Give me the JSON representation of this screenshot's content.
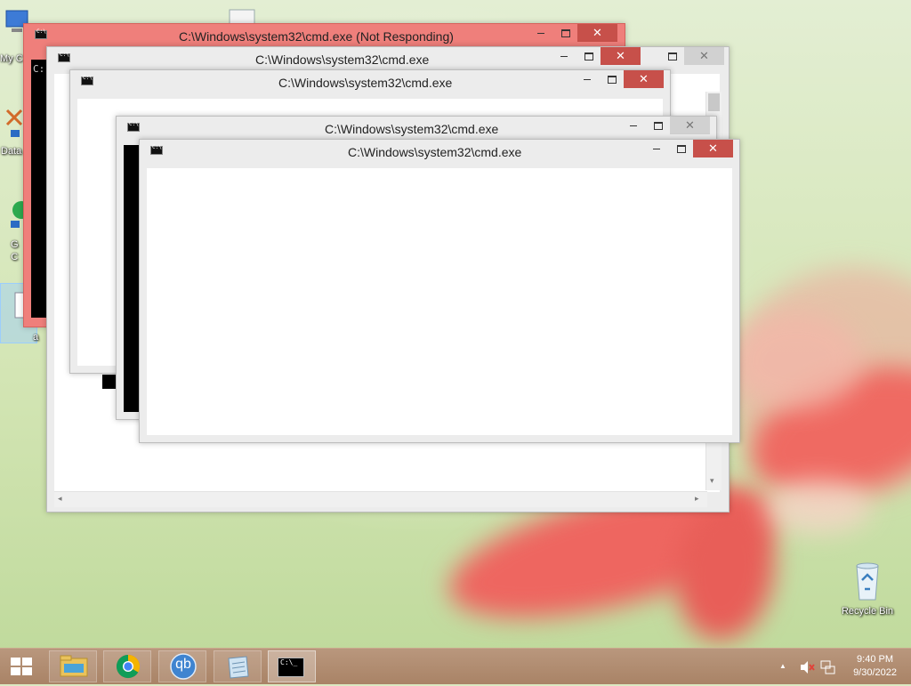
{
  "desktop": {
    "icons": [
      {
        "label": "My C"
      },
      {
        "label": "Data"
      },
      {
        "label": "G\nC"
      },
      {
        "label": "a"
      },
      {
        "label": "Recycle Bin"
      }
    ]
  },
  "windows": [
    {
      "title": "C:\\Windows\\system32\\cmd.exe (Not Responding)",
      "state": "not-responding"
    },
    {
      "title": "C:\\Windows\\system32\\cmd.exe"
    },
    {
      "title": "C:\\Windows\\system32\\cmd.exe"
    },
    {
      "title": "C:\\Windows\\system32\\cmd.exe"
    },
    {
      "title": "C:\\Windows\\system32\\cmd.exe",
      "state": "active"
    }
  ],
  "console_prompt": "C:",
  "window_buttons": {
    "close": "✕"
  },
  "taskbar": {
    "apps": [
      "file-explorer",
      "chrome",
      "qbittorrent",
      "notepad",
      "command-prompt"
    ],
    "qb_label": "qb",
    "cmd_label": "C:\\_",
    "tray_arrow": "▲",
    "clock": {
      "time": "9:40 PM",
      "date": "9/30/2022"
    }
  },
  "colors": {
    "not_responding_frame": "#ef7f7b",
    "close_button": "#c7504a",
    "taskbar": "#a98366",
    "wallpaper_flower": "#ef6a62"
  }
}
